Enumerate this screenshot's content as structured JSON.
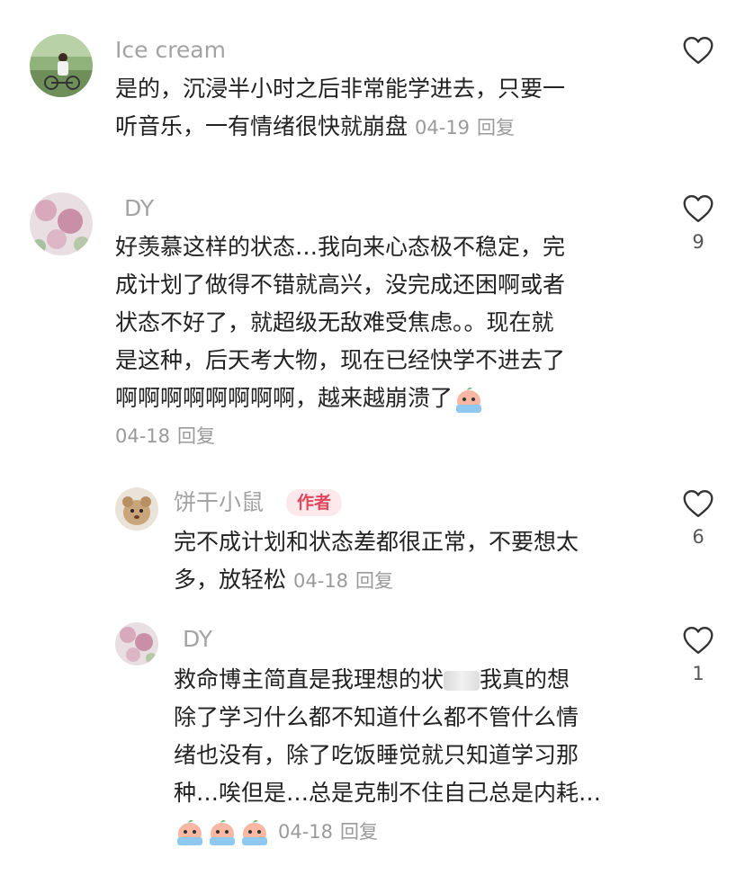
{
  "comments": [
    {
      "username": "Ice cream",
      "lines": [
        "是的，沉浸半小时之后非常能学进去，只要一",
        "听音乐，一有情绪很快就崩盘"
      ],
      "date": "04-19",
      "reply_label": "回复",
      "like_count": ""
    },
    {
      "username": "DY",
      "lines": [
        "好羡慕这样的状态…我向来心态极不稳定，完",
        "成计划了做得不错就高兴，没完成还困啊或者",
        "状态不好了，就超级无敌难受焦虑。。现在就",
        "是这种，后天考大物，现在已经快学不进去了",
        "啊啊啊啊啊啊啊啊，越来越崩溃了"
      ],
      "date": "04-18",
      "reply_label": "回复",
      "like_count": "9"
    }
  ],
  "replies": [
    {
      "username": "饼干小鼠",
      "badge": "作者",
      "lines": [
        "完不成计划和状态差都很正常，不要想太",
        "多，放轻松"
      ],
      "date": "04-18",
      "reply_label": "回复",
      "like_count": "6"
    },
    {
      "username": "DY",
      "lines": [
        "救命博主简直是我理想的状",
        "我真的想",
        "除了学习什么都不知道什么都不管什么情",
        "绪也没有，除了吃饭睡觉就只知道学习那",
        "种…唉但是…总是克制不住自己总是内耗…"
      ],
      "date": "04-18",
      "reply_label": "回复",
      "like_count": "1"
    }
  ],
  "icons": {
    "like": "heart-outline-icon",
    "emoji": "crying-peach-emoji"
  },
  "colors": {
    "author_badge_text": "#e0465c",
    "author_badge_bg": "#fde9ec",
    "username": "#a3a3a3",
    "meta": "#9a9a9a"
  }
}
